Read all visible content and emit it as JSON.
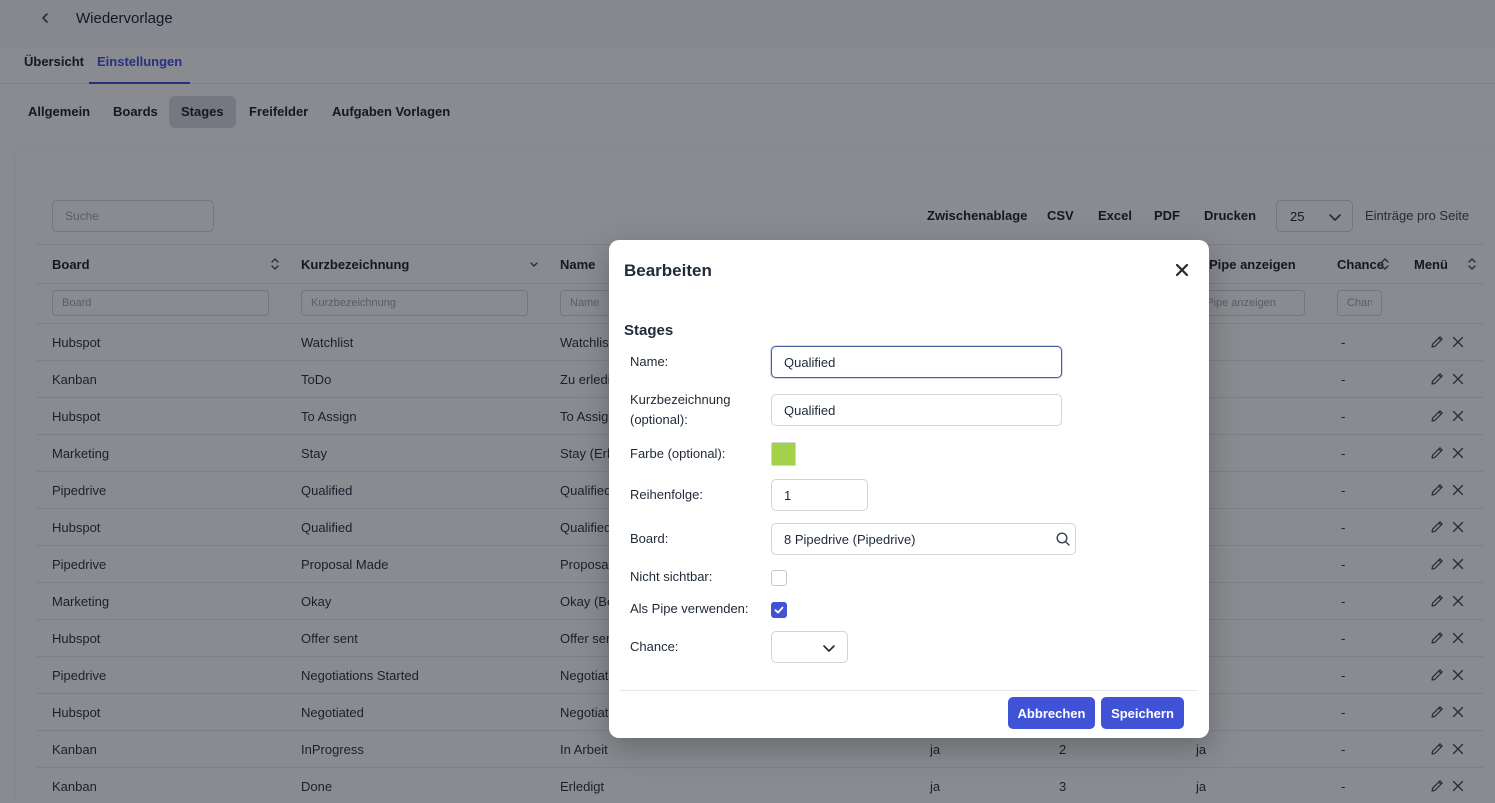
{
  "header": {
    "title": "Wiedervorlage",
    "back_icon": "chevron-left-icon"
  },
  "tabs": [
    {
      "label": "Übersicht",
      "active": false
    },
    {
      "label": "Einstellungen",
      "active": true
    }
  ],
  "subtabs": [
    {
      "label": "Allgemein",
      "active": false
    },
    {
      "label": "Boards",
      "active": false
    },
    {
      "label": "Stages",
      "active": true
    },
    {
      "label": "Freifelder",
      "active": false
    },
    {
      "label": "Aufgaben Vorlagen",
      "active": false
    }
  ],
  "toolbar": {
    "search_placeholder": "Suche",
    "exports": [
      "Zwischenablage",
      "CSV",
      "Excel",
      "PDF",
      "Drucken"
    ],
    "page_size": "25",
    "per_page_label": "Einträge pro Seite"
  },
  "table": {
    "columns": [
      "Board",
      "Kurzbezeichnung",
      "Name",
      "Pipe anzeigen",
      "Chance",
      "Menü"
    ],
    "filter_placeholders": [
      "Board",
      "Kurzbezeichnung",
      "Name",
      "n Pipe anzeigen",
      "Chan"
    ],
    "rows": [
      {
        "board": "Hubspot",
        "kurz": "Watchlist",
        "name": "Watchlist",
        "c4": "",
        "c5": "",
        "c6": "",
        "chance": "-"
      },
      {
        "board": "Kanban",
        "kurz": "ToDo",
        "name": "Zu erledi",
        "c4": "",
        "c5": "",
        "c6": "",
        "chance": "-"
      },
      {
        "board": "Hubspot",
        "kurz": "To Assign",
        "name": "To Assig",
        "c4": "",
        "c5": "",
        "c6": "",
        "chance": "-"
      },
      {
        "board": "Marketing",
        "kurz": "Stay",
        "name": "Stay (Erh",
        "c4": "",
        "c5": "",
        "c6": "",
        "chance": "-"
      },
      {
        "board": "Pipedrive",
        "kurz": "Qualified",
        "name": "Qualified",
        "c4": "",
        "c5": "",
        "c6": "",
        "chance": "-"
      },
      {
        "board": "Hubspot",
        "kurz": "Qualified",
        "name": "Qualified",
        "c4": "",
        "c5": "",
        "c6": "",
        "chance": "-"
      },
      {
        "board": "Pipedrive",
        "kurz": "Proposal Made",
        "name": "Proposal",
        "c4": "",
        "c5": "",
        "c6": "",
        "chance": "-"
      },
      {
        "board": "Marketing",
        "kurz": "Okay",
        "name": "Okay (Be",
        "c4": "",
        "c5": "",
        "c6": "",
        "chance": "-"
      },
      {
        "board": "Hubspot",
        "kurz": "Offer sent",
        "name": "Offer ser",
        "c4": "",
        "c5": "",
        "c6": "",
        "chance": "-"
      },
      {
        "board": "Pipedrive",
        "kurz": "Negotiations Started",
        "name": "Negotiat",
        "c4": "",
        "c5": "",
        "c6": "",
        "chance": "-"
      },
      {
        "board": "Hubspot",
        "kurz": "Negotiated",
        "name": "Negotiat",
        "c4": "",
        "c5": "",
        "c6": "",
        "chance": "-"
      },
      {
        "board": "Kanban",
        "kurz": "InProgress",
        "name": "In Arbeit",
        "c4": "ja",
        "c5": "2",
        "c6": "ja",
        "chance": "-"
      },
      {
        "board": "Kanban",
        "kurz": "Done",
        "name": "Erledigt",
        "c4": "ja",
        "c5": "3",
        "c6": "ja",
        "chance": "-"
      }
    ],
    "row_icons": [
      "pencil-icon",
      "x-icon"
    ]
  },
  "modal": {
    "title": "Bearbeiten",
    "section": "Stages",
    "labels": {
      "name": "Name:",
      "kurz_line1": "Kurzbezeichnung",
      "kurz_line2": "(optional):",
      "farbe": "Farbe (optional):",
      "reihenfolge": "Reihenfolge:",
      "board": "Board:",
      "nicht_sichtbar": "Nicht sichtbar:",
      "als_pipe": "Als Pipe verwenden:",
      "chance": "Chance:"
    },
    "values": {
      "name": "Qualified",
      "kurz": "Qualified",
      "farbe": "#a3d14a",
      "reihenfolge": "1",
      "board": "8 Pipedrive (Pipedrive)",
      "nicht_sichtbar": false,
      "als_pipe": true,
      "chance": ""
    },
    "buttons": {
      "cancel": "Abbrechen",
      "save": "Speichern"
    }
  },
  "colors": {
    "accent": "#4052d6",
    "tab_active": "#3b4bdc",
    "swatch": "#a3d14a"
  }
}
